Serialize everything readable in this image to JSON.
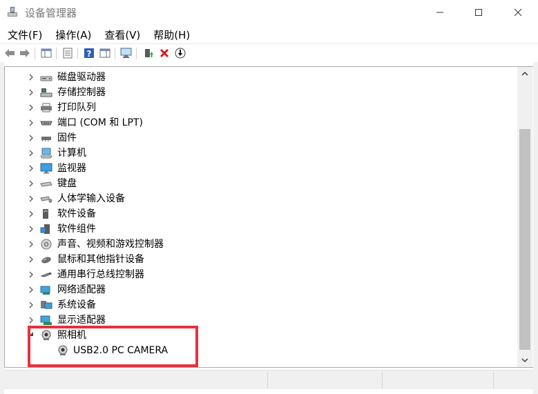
{
  "window": {
    "title": "设备管理器"
  },
  "menu": {
    "items": [
      "文件(F)",
      "操作(A)",
      "查看(V)",
      "帮助(H)"
    ]
  },
  "tree": {
    "categories": [
      {
        "label": "磁盘驱动器",
        "icon": "disk-drive-icon"
      },
      {
        "label": "存储控制器",
        "icon": "storage-controller-icon"
      },
      {
        "label": "打印队列",
        "icon": "printer-icon"
      },
      {
        "label": "端口 (COM 和 LPT)",
        "icon": "port-icon"
      },
      {
        "label": "固件",
        "icon": "firmware-icon"
      },
      {
        "label": "计算机",
        "icon": "computer-icon"
      },
      {
        "label": "监视器",
        "icon": "monitor-icon"
      },
      {
        "label": "键盘",
        "icon": "keyboard-icon"
      },
      {
        "label": "人体学输入设备",
        "icon": "hid-icon"
      },
      {
        "label": "软件设备",
        "icon": "software-device-icon"
      },
      {
        "label": "软件组件",
        "icon": "software-component-icon"
      },
      {
        "label": "声音、视频和游戏控制器",
        "icon": "sound-icon"
      },
      {
        "label": "鼠标和其他指针设备",
        "icon": "mouse-icon"
      },
      {
        "label": "通用串行总线控制器",
        "icon": "usb-icon"
      },
      {
        "label": "网络适配器",
        "icon": "network-adapter-icon"
      },
      {
        "label": "系统设备",
        "icon": "system-device-icon"
      },
      {
        "label": "显示适配器",
        "icon": "display-adapter-icon"
      }
    ],
    "expanded": {
      "label": "照相机",
      "icon": "camera-icon"
    },
    "child": {
      "label": "USB2.0 PC CAMERA",
      "icon": "webcam-icon"
    }
  },
  "colors": {
    "highlight": "#e8303f",
    "scroll_thumb": "#c1c1c1"
  }
}
